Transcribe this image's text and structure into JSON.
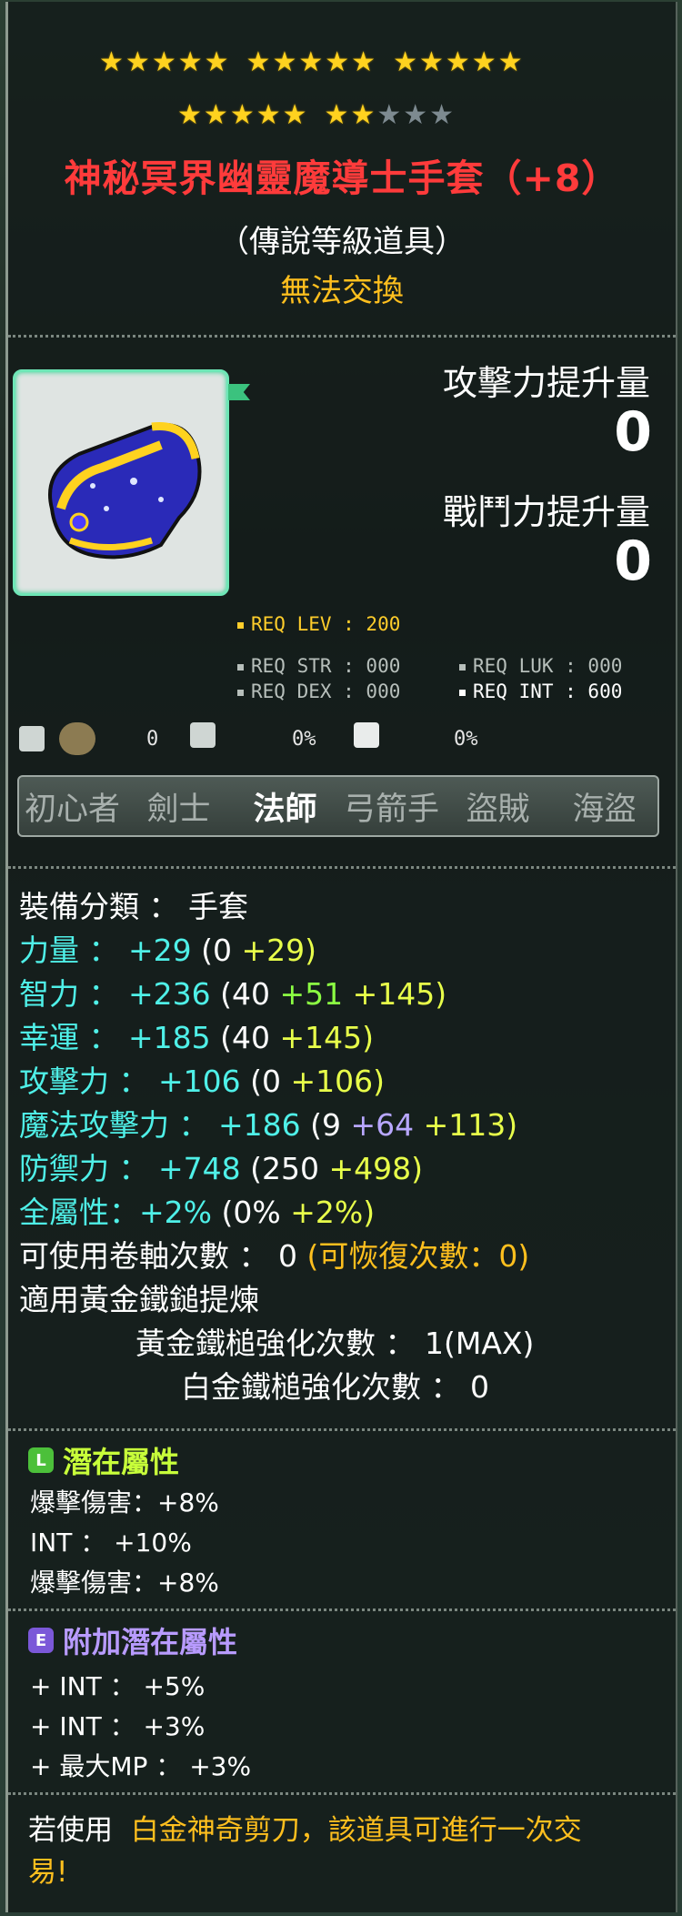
{
  "stars": {
    "row1": [
      5,
      5,
      5
    ],
    "row2_gold": 5,
    "row2_mixed": {
      "on": 2,
      "off": 3
    }
  },
  "item": {
    "name": "神秘冥界幽靈魔導士手套（+8）",
    "grade": "（傳說等級道具）",
    "trade": "無法交換"
  },
  "upgrade": {
    "atk_label": "攻擊力提升量",
    "atk_value": "0",
    "combat_label": "戰鬥力提升量",
    "combat_value": "0"
  },
  "requirements": {
    "lev": "REQ LEV : 200",
    "str": "REQ STR : 000",
    "luk": "REQ LUK : 000",
    "dex": "REQ DEX : 000",
    "int": "REQ INT : 600"
  },
  "mini": {
    "v1": "0",
    "v2": "0%",
    "v3": "0%"
  },
  "classes": [
    "初心者",
    "劍士",
    "法師",
    "弓箭手",
    "盜賊",
    "海盜"
  ],
  "active_class": "法師",
  "stats": {
    "category": "裝備分類 ： 手套",
    "str": {
      "label": "力量",
      "total": "+29",
      "base": "(0",
      "bonus": "+29)"
    },
    "int": {
      "label": "智力",
      "total": "+236",
      "base": "(40",
      "b1": "+51",
      "b2": "+145)"
    },
    "luk": {
      "label": "幸運",
      "total": "+185",
      "base": "(40",
      "b2": "+145)"
    },
    "atk": {
      "label": "攻擊力",
      "total": "+106",
      "base": "(0",
      "b2": "+106)"
    },
    "matk": {
      "label": "魔法攻擊力",
      "total": "+186",
      "base": "(9",
      "b1": "+64",
      "b2": "+113)"
    },
    "def": {
      "label": "防禦力",
      "total": "+748",
      "base": "(250",
      "b2": "+498)"
    },
    "all": {
      "label": "全屬性：",
      "total": "+2%",
      "base": "(0%",
      "b2": "+2%)"
    },
    "scroll": "可使用卷軸次數 ： 0",
    "scroll_restore": "(可恢復次數：0)",
    "hammer_title": "適用黃金鐵鎚提煉",
    "gold_hammer": "黃金鐵槌強化次數 ： 1(MAX)",
    "plat_hammer": "白金鐵槌強化次數 ： 0"
  },
  "potential": {
    "title": "潛在屬性",
    "badge": "L",
    "lines": [
      "爆擊傷害：+8%",
      "INT ： +10%",
      "爆擊傷害：+8%"
    ]
  },
  "bonus_potential": {
    "title": "附加潛在屬性",
    "badge": "E",
    "lines": [
      "+ INT ： +5%",
      "+ INT ： +3%",
      "+ 最大MP ： +3%"
    ]
  },
  "footer": {
    "prefix": "若使用",
    "highlight": "白金神奇剪刀，該道具可進行一次交",
    "line2": "易!"
  }
}
